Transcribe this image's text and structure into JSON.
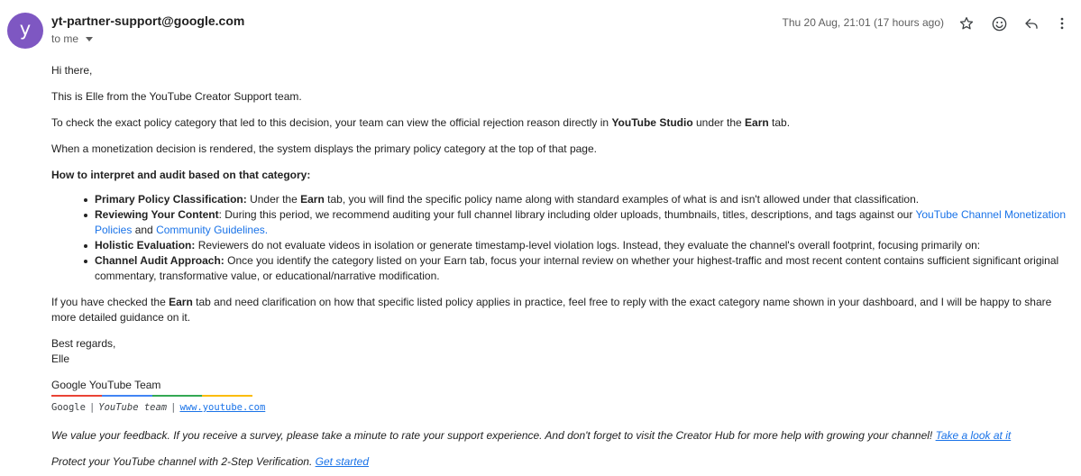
{
  "sender": {
    "avatar_letter": "y",
    "email": "yt-partner-support@google.com",
    "to_label": "to me",
    "timestamp": "Thu 20 Aug, 21:01 (17 hours ago)"
  },
  "icons": [
    "star-icon",
    "emoji-icon",
    "reply-icon",
    "more-vertical-icon"
  ],
  "body": {
    "greeting": "Hi there,",
    "intro": "This is Elle from the YouTube Creator Support team.",
    "p1": {
      "before": "To check the exact policy category that led to this decision, your team can view the official rejection reason directly in ",
      "bold1": "YouTube Studio",
      "mid": " under the ",
      "bold2": "Earn",
      "after": " tab."
    },
    "p2": "When a monetization decision is rendered, the system displays the primary policy category at the top of that page.",
    "heading": "How to interpret and audit based on that category:",
    "bullets": {
      "b1": {
        "label": "Primary Policy Classification:",
        "before": " Under the ",
        "bold": "Earn",
        "after": " tab, you will find the specific policy name along with standard examples of what is and isn't allowed under that classification."
      },
      "b2": {
        "label": "Reviewing Your Content",
        "before": ": During this period, we recommend auditing your full channel library including older uploads, thumbnails, titles, descriptions, and tags against our ",
        "link1": "YouTube Channel Monetization Policies",
        "mid": " and ",
        "link2": "Community Guidelines."
      },
      "b3": {
        "label": "Holistic Evaluation:",
        "text": " Reviewers do not evaluate videos in isolation or generate timestamp-level violation logs. Instead, they evaluate the channel's overall footprint, focusing primarily on:"
      },
      "b4": {
        "label": "Channel Audit Approach:",
        "text": " Once you identify the category listed on your Earn tab, focus your internal review on whether your highest-traffic and most recent content contains sufficient significant original commentary, transformative value, or educational/narrative modification."
      }
    },
    "p3": {
      "before": "If you have checked the ",
      "bold": "Earn",
      "after": " tab and need clarification on how that specific listed policy applies in practice, feel free to reply with the exact category name shown in your dashboard, and I will be happy to share more detailed guidance on it."
    },
    "closing": "Best regards,",
    "name": "Elle"
  },
  "signature": {
    "title": "Google YouTube Team",
    "company": "Google",
    "separator": "|",
    "team": "YouTube team",
    "url": "www.youtube.com",
    "bar_colors": [
      "#ea4335",
      "#4285f4",
      "#34a853",
      "#fbbc05"
    ]
  },
  "footer": {
    "feedback_text": "We value your feedback. If you receive a survey, please take a minute to rate your support experience. And don't forget to visit the Creator Hub for more help with growing your channel! ",
    "feedback_link": "Take a look at it",
    "security_text": "Protect your YouTube channel with 2-Step Verification. ",
    "security_link": "Get started"
  }
}
